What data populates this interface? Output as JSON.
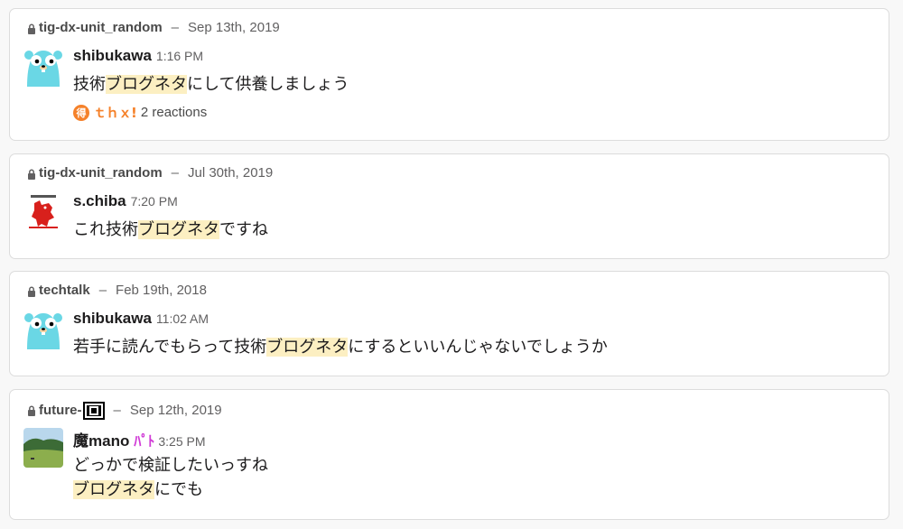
{
  "results": [
    {
      "channel": "tig-dx-unit_random",
      "separator": "–",
      "date": "Sep 13th, 2019",
      "avatar_icon": "gopher-icon",
      "sender": "shibukawa",
      "time": "1:16 PM",
      "text_before": "技術",
      "highlight": "ブログネタ",
      "text_after": "にして供養しましょう",
      "reaction_emoji_1": "得",
      "reaction_emoji_2": "ｔｈｘ!",
      "reactions_label": "2 reactions"
    },
    {
      "channel": "tig-dx-unit_random",
      "separator": "–",
      "date": "Jul 30th, 2019",
      "avatar_icon": "chiba-mascot-icon",
      "sender": "s.chiba",
      "time": "7:20 PM",
      "text_before": "これ技術",
      "highlight": "ブログネタ",
      "text_after": "ですね"
    },
    {
      "channel": "techtalk",
      "separator": "–",
      "date": "Feb 19th, 2018",
      "avatar_icon": "gopher-icon",
      "sender": "shibukawa",
      "time": "11:02 AM",
      "text_before": "若手に読んでもらって技術",
      "highlight": "ブログネタ",
      "text_after": "にするといいんじゃないでしょうか"
    },
    {
      "channel": "future-",
      "separator": "–",
      "date": "Sep 12th, 2019",
      "avatar_icon": "landscape-photo-icon",
      "sender": "魔mano",
      "sender_emoji": "ﾊﾟﾄ",
      "time": "3:25 PM",
      "line1": "どっかで検証したいっすね",
      "highlight": "ブログネタ",
      "text_after": "にでも"
    }
  ],
  "colors": {
    "highlight": "#fcefc2",
    "card_border": "#dcdcdc",
    "reaction_orange": "#f5812a",
    "emoji_magenta": "#d03bd6"
  }
}
